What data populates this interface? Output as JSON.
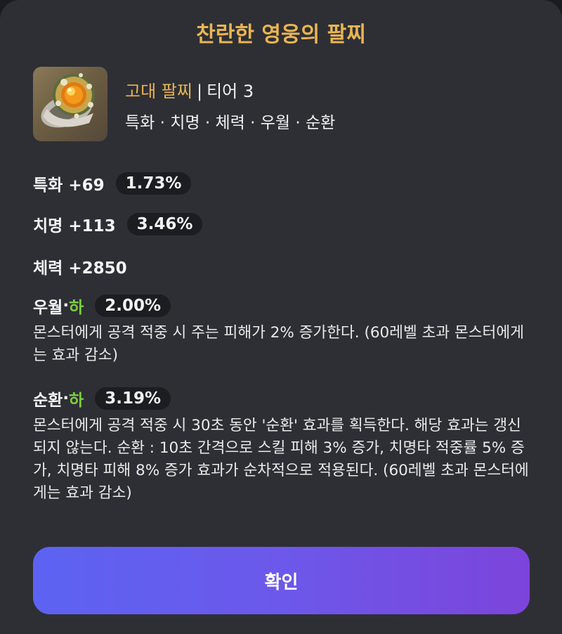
{
  "dialog": {
    "title": "찬란한 영웅의 팔찌",
    "confirm_label": "확인"
  },
  "item": {
    "icon": "bracelet-icon",
    "grade": "고대 팔찌",
    "separator": "|",
    "tier": "티어 3",
    "stats_summary": "특화 · 치명 · 체력 · 우월 · 순환"
  },
  "stats": [
    {
      "label": "특화 +69",
      "percent": "1.73%"
    },
    {
      "label": "치명 +113",
      "percent": "3.46%"
    },
    {
      "label": "체력 +2850"
    }
  ],
  "effects": [
    {
      "name": "우월",
      "dot": " · ",
      "grade": "하",
      "percent": "2.00%",
      "description": "몬스터에게 공격 적중 시 주는 피해가 2% 증가한다. (60레벨 초과 몬스터에게는 효과 감소)"
    },
    {
      "name": "순환",
      "dot": " · ",
      "grade": "하",
      "percent": "3.19%",
      "description": "몬스터에게 공격 적중 시 30초 동안 '순환' 효과를 획득한다. 해당 효과는 갱신되지 않는다. 순환 : 10초 간격으로 스킬 피해 3% 증가, 치명타 적중률 5% 증가, 치명타 피해 8% 증가 효과가 순차적으로 적용된다. (60레벨 초과 몬스터에게는 효과 감소)"
    }
  ],
  "colors": {
    "title": "#e9b552",
    "grade_low": "#7bd03c",
    "background": "#2e2f35",
    "pill": "#1c1d21",
    "button_start": "#5c63f2",
    "button_end": "#7c44db"
  }
}
